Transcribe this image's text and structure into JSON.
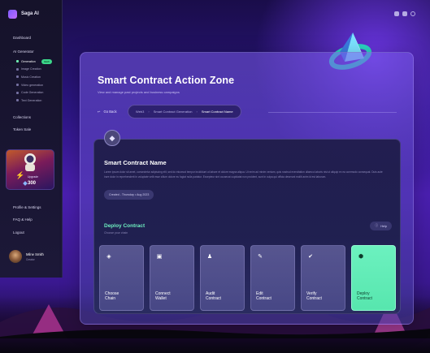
{
  "app": {
    "name": "Saga AI"
  },
  "sidebar": {
    "top_item": "Dashboard",
    "section": "AI Generator",
    "sub_items": [
      {
        "label": "Generation",
        "badge": "NEW",
        "active": true
      },
      {
        "label": "Image Creation",
        "badge": "",
        "active": false
      },
      {
        "label": "Music Creation",
        "badge": "",
        "active": false
      },
      {
        "label": "Video generation",
        "badge": "",
        "active": false
      },
      {
        "label": "Code Generation",
        "badge": "",
        "active": false
      },
      {
        "label": "Text Generation",
        "badge": "",
        "active": false
      }
    ],
    "collections": "Collections",
    "token_sale": "Token Sale",
    "upgrade": {
      "label": "Upgrade",
      "price": "300"
    },
    "profile_settings": "Profile & Settings",
    "faq": "FAQ & Help",
    "logout": "Logout",
    "user": {
      "name": "Milne Smith",
      "role": "Creator"
    }
  },
  "main": {
    "title": "Smart Contract Action Zone",
    "subtitle": "View and manage past projects and business campaigns",
    "go_back": "Go Back",
    "breadcrumbs": [
      "Web3",
      "Smart Contract Generation",
      "Smart Contract Name"
    ]
  },
  "contract": {
    "icon": "ethereum-icon",
    "name": "Smart Contract Name",
    "description": "Lorem ipsum dolor sit amet, consectetur adipiscing elit, sed do eiusmod tempor incididunt ut labore et dolore magna aliqua. Ut enim ad minim veniam, quis nostrud exercitation ullamco laboris nisi ut aliquip ex ea commodo consequat. Duis aute irure dolor in reprehenderit in voluptate velit esse cillum dolore eu fugiat nulla pariatur. Excepteur sint occaecat cupidatat non proident, sunt in culpa qui officia deserunt mollit anim id est laborum.",
    "created": "Created - Thursday • Aug 2023"
  },
  "deploy": {
    "title": "Deploy Contract",
    "subtitle": "Choose your chain",
    "help": "Help",
    "steps": [
      {
        "label": "Choose\nChain",
        "icon": "chain-icon",
        "active": false
      },
      {
        "label": "Connect\nWallet",
        "icon": "wallet-icon",
        "active": false
      },
      {
        "label": "Audit\nContract",
        "icon": "audit-icon",
        "active": false
      },
      {
        "label": "Edit\nContract",
        "icon": "edit-icon",
        "active": false
      },
      {
        "label": "Verify\nContract",
        "icon": "verify-icon",
        "active": false
      },
      {
        "label": "Deploy\nContract",
        "icon": "deploy-icon",
        "active": true
      }
    ]
  },
  "colors": {
    "accent": "#6cf1bf",
    "panel": "#5a44c0",
    "sidebar": "#15122a"
  }
}
